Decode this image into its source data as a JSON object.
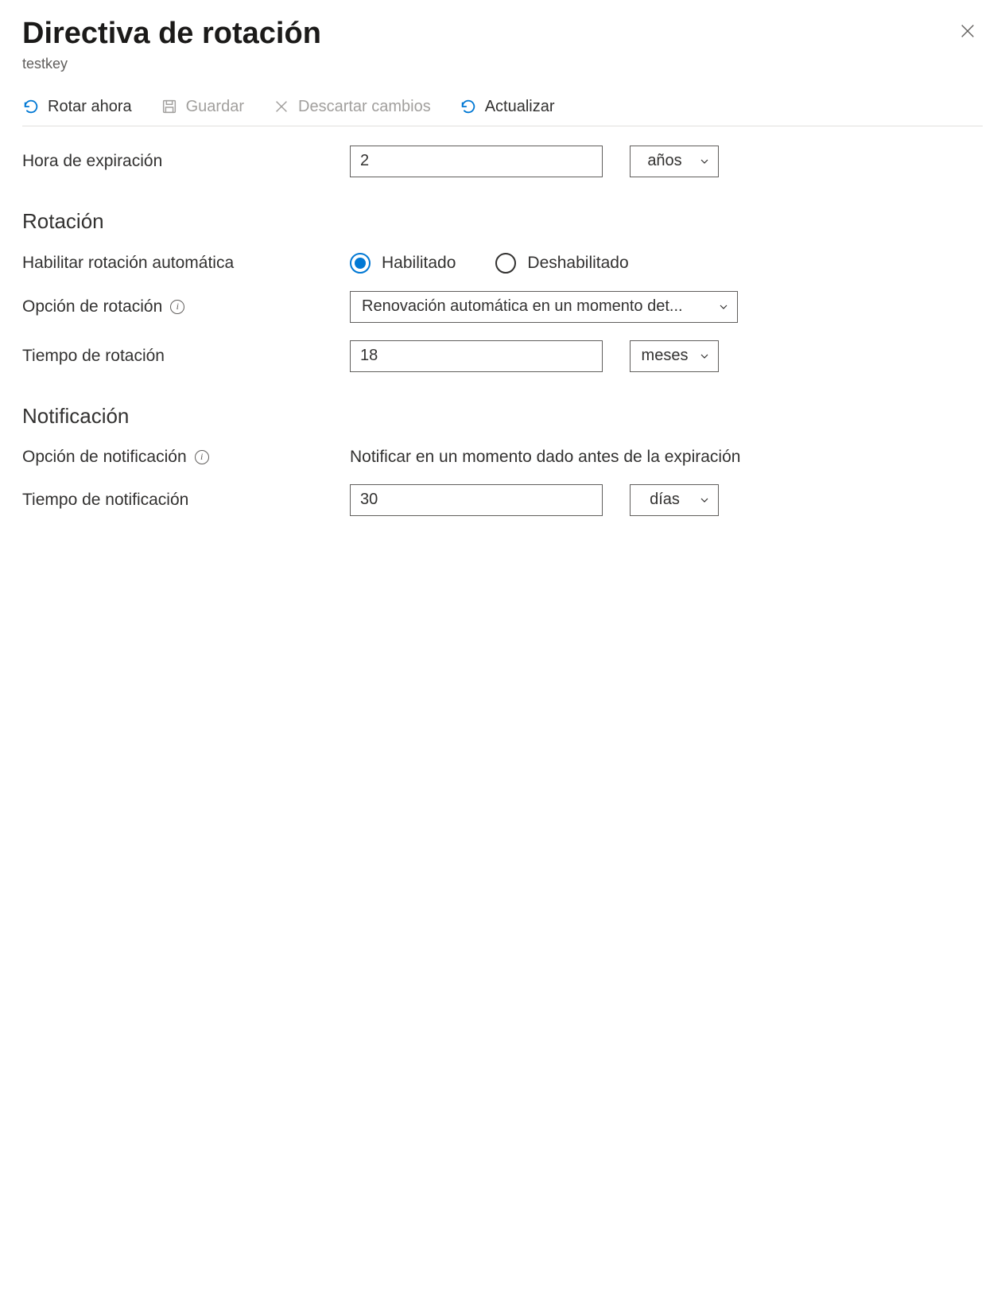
{
  "header": {
    "title": "Directiva de rotación",
    "subtitle": "testkey"
  },
  "toolbar": {
    "rotate_now": "Rotar ahora",
    "save": "Guardar",
    "discard": "Descartar cambios",
    "refresh": "Actualizar"
  },
  "expiry": {
    "label": "Hora de expiración",
    "value": "2",
    "unit": "años"
  },
  "rotation": {
    "heading": "Rotación",
    "enable_label": "Habilitar rotación automática",
    "enabled_option": "Habilitado",
    "disabled_option": "Deshabilitado",
    "option_label": "Opción de rotación",
    "option_value": "Renovación automática en un momento det...",
    "time_label": "Tiempo de rotación",
    "time_value": "18",
    "time_unit": "meses"
  },
  "notification": {
    "heading": "Notificación",
    "option_label": "Opción de notificación",
    "option_value": "Notificar en un momento dado antes de la expiración",
    "time_label": "Tiempo de notificación",
    "time_value": "30",
    "time_unit": "días"
  }
}
